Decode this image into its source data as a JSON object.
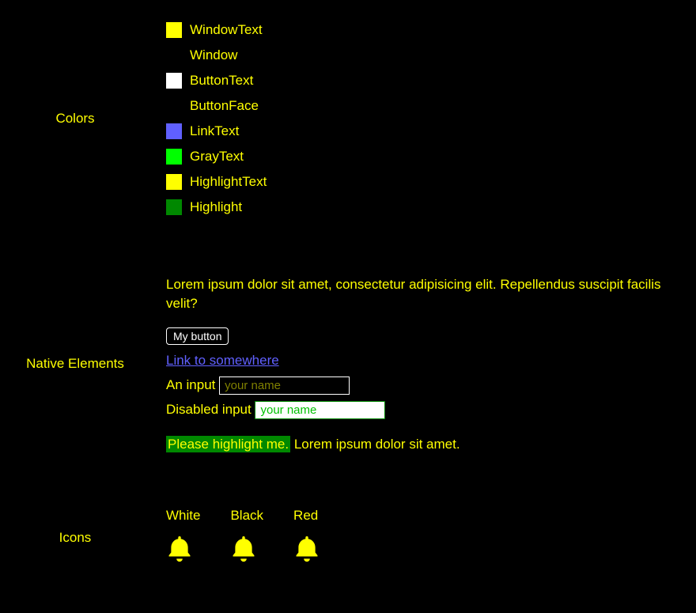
{
  "sections": {
    "colors": {
      "label": "Colors",
      "items": [
        {
          "name": "WindowText",
          "swatch": "#ffff00"
        },
        {
          "name": "Window",
          "swatch": null
        },
        {
          "name": "ButtonText",
          "swatch": "#ffffff"
        },
        {
          "name": "ButtonFace",
          "swatch": null
        },
        {
          "name": "LinkText",
          "swatch": "#6060ff"
        },
        {
          "name": "GrayText",
          "swatch": "#00ff00"
        },
        {
          "name": "HighlightText",
          "swatch": "#ffff00"
        },
        {
          "name": "Highlight",
          "swatch": "#008800"
        }
      ]
    },
    "native": {
      "label": "Native Elements",
      "paragraph": "Lorem ipsum dolor sit amet, consectetur adipisicing elit. Repellendus suscipit facilis velit?",
      "button_label": "My button",
      "link_text": "Link to somewhere",
      "input": {
        "label": "An input",
        "placeholder": "your name"
      },
      "disabled_input": {
        "label": "Disabled input",
        "placeholder": "your name"
      },
      "highlight": {
        "highlighted": "Please highlight me.",
        "rest": " Lorem ipsum dolor sit amet."
      }
    },
    "icons": {
      "label": "Icons",
      "items": [
        {
          "label": "White",
          "color": "#ffff00"
        },
        {
          "label": "Black",
          "color": "#ffff00"
        },
        {
          "label": "Red",
          "color": "#ffff00"
        }
      ]
    }
  }
}
